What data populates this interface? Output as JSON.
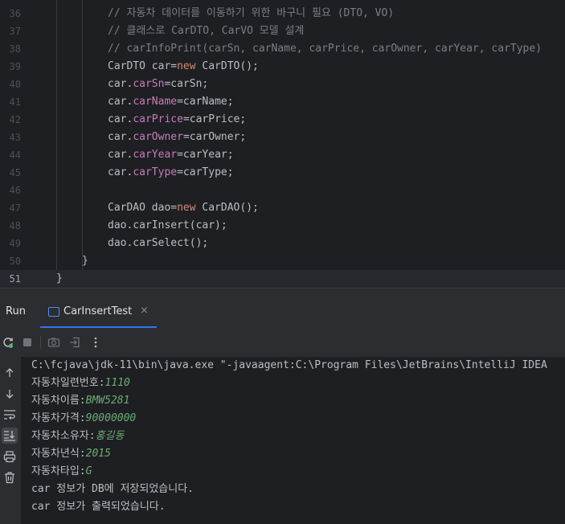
{
  "editor": {
    "lines": [
      {
        "num": "36",
        "tokens": [
          {
            "t": "// 자동차 데이터를 이동하기 위한 바구니 필요 (DTO, VO)",
            "c": "comment"
          }
        ]
      },
      {
        "num": "37",
        "tokens": [
          {
            "t": "// 클래스로 CarDTO, CarVO 모델 설계",
            "c": "comment"
          }
        ]
      },
      {
        "num": "38",
        "tokens": [
          {
            "t": "// carInfoPrint(carSn, carName, carPrice, carOwner, carYear, carType)",
            "c": "comment"
          }
        ]
      },
      {
        "num": "39",
        "tokens": [
          {
            "t": "CarDTO car=",
            "c": "plain"
          },
          {
            "t": "new",
            "c": "keyword"
          },
          {
            "t": " CarDTO();",
            "c": "plain"
          }
        ]
      },
      {
        "num": "40",
        "tokens": [
          {
            "t": "car.",
            "c": "plain"
          },
          {
            "t": "carSn",
            "c": "field"
          },
          {
            "t": "=carSn;",
            "c": "plain"
          }
        ]
      },
      {
        "num": "41",
        "tokens": [
          {
            "t": "car.",
            "c": "plain"
          },
          {
            "t": "carName",
            "c": "field"
          },
          {
            "t": "=carName;",
            "c": "plain"
          }
        ]
      },
      {
        "num": "42",
        "tokens": [
          {
            "t": "car.",
            "c": "plain"
          },
          {
            "t": "carPrice",
            "c": "field"
          },
          {
            "t": "=carPrice;",
            "c": "plain"
          }
        ]
      },
      {
        "num": "43",
        "tokens": [
          {
            "t": "car.",
            "c": "plain"
          },
          {
            "t": "carOwner",
            "c": "field"
          },
          {
            "t": "=carOwner;",
            "c": "plain"
          }
        ]
      },
      {
        "num": "44",
        "tokens": [
          {
            "t": "car.",
            "c": "plain"
          },
          {
            "t": "carYear",
            "c": "field"
          },
          {
            "t": "=carYear;",
            "c": "plain"
          }
        ]
      },
      {
        "num": "45",
        "tokens": [
          {
            "t": "car.",
            "c": "plain"
          },
          {
            "t": "carType",
            "c": "field"
          },
          {
            "t": "=carType;",
            "c": "plain"
          }
        ]
      },
      {
        "num": "46",
        "tokens": []
      },
      {
        "num": "47",
        "tokens": [
          {
            "t": "CarDAO dao=",
            "c": "plain"
          },
          {
            "t": "new",
            "c": "keyword"
          },
          {
            "t": " CarDAO();",
            "c": "plain"
          }
        ]
      },
      {
        "num": "48",
        "tokens": [
          {
            "t": "dao.carInsert(car);",
            "c": "plain"
          }
        ]
      },
      {
        "num": "49",
        "tokens": [
          {
            "t": "dao.carSelect();",
            "c": "plain"
          }
        ]
      },
      {
        "num": "50",
        "tokens": [
          {
            "t": "}",
            "c": "plain"
          }
        ]
      },
      {
        "num": "51",
        "tokens": [
          {
            "t": "}",
            "c": "plain"
          }
        ],
        "current": true
      }
    ]
  },
  "run_panel": {
    "title": "Run",
    "tab_label": "CarInsertTest",
    "tab_close": "×"
  },
  "console": {
    "lines": [
      {
        "label": "C:\\fcjava\\jdk-11\\bin\\java.exe \"-javaagent:C:\\Program Files\\JetBrains\\IntelliJ IDEA",
        "value": ""
      },
      {
        "label": "자동차일련번호:",
        "value": "1110"
      },
      {
        "label": "자동차이름:",
        "value": "BMW5281"
      },
      {
        "label": "자동차가격:",
        "value": "90000000"
      },
      {
        "label": "자동차소유자:",
        "value": "홍길동"
      },
      {
        "label": "자동차년식:",
        "value": "2015"
      },
      {
        "label": "자동차타입:",
        "value": "G"
      },
      {
        "label": "car 정보가 DB에 저장되었습니다.",
        "value": ""
      },
      {
        "label": "car 정보가 출력되었습니다.",
        "value": ""
      }
    ]
  },
  "colors": {
    "comment": "#7a7e85",
    "keyword": "#cf8e6d",
    "field": "#c77dbb",
    "console_value": "#6aab73",
    "accent": "#3574f0"
  },
  "toolbar_icons": [
    "rerun-icon",
    "stop-icon",
    "screenshot-icon",
    "exit-icon",
    "more-icon"
  ],
  "side_icons": [
    "arrow-up-icon",
    "arrow-down-icon",
    "soft-wrap-icon",
    "scroll-to-end-icon",
    "print-icon",
    "trash-icon"
  ]
}
